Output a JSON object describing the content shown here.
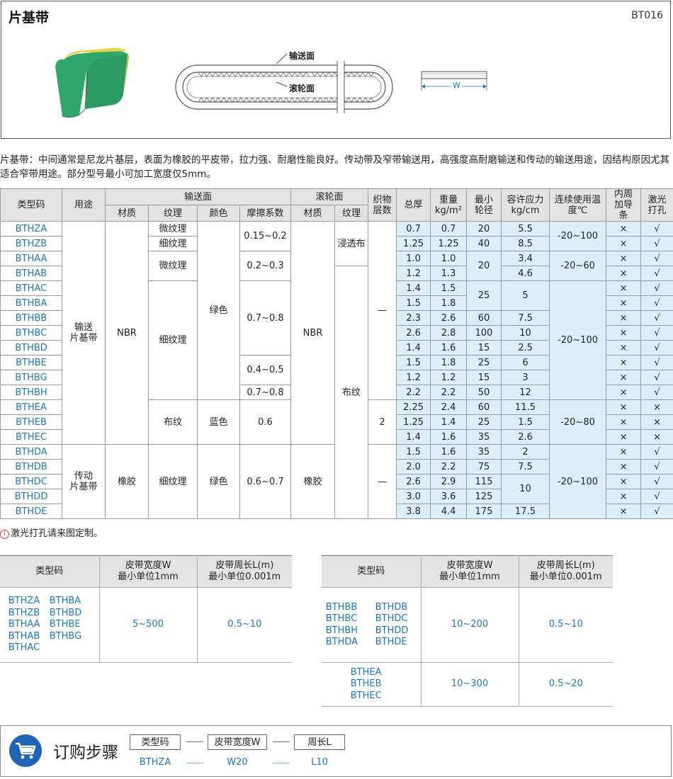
{
  "header": {
    "title": "片基带",
    "code": "BT016"
  },
  "diagram": {
    "convey_label": "输送面",
    "roller_label": "滚轮面",
    "width_label": "W"
  },
  "description": "片基带：中间通常是尼龙片基层，表面为橡胶的平皮带，拉力强、耐磨性能良好。传动带及窄带输送用，高强度高耐磨输送和传动的输送用途，因结构原因尤其适合窄带用途。部分型号最小可加工宽度仅5mm。",
  "spec_table": {
    "headers": {
      "model": "类型码",
      "usage": "用途",
      "convey": "输送面",
      "roller": "滚轮面",
      "plies": "织物层数",
      "thickness": "总厚",
      "weight": "重量",
      "weight_unit": "kg/m²",
      "min_pulley": "最小轮径",
      "stress": "容许应力",
      "stress_unit": "kg/cm",
      "temp": "连续使用温度℃",
      "guide": "内周加导条",
      "laser": "激光打孔",
      "material": "材质",
      "texture": "纹理",
      "color": "颜色",
      "friction": "摩擦系数"
    },
    "rows": [
      {
        "model": "BTHZA",
        "thickness": "0.7",
        "weight": "0.7",
        "pulley": "20",
        "stress": "5.5",
        "guide": "×",
        "laser": "√"
      },
      {
        "model": "BTHZB",
        "thickness": "1.25",
        "weight": "1.25",
        "pulley": "40",
        "stress": "8.5",
        "guide": "×",
        "laser": "√"
      },
      {
        "model": "BTHAA",
        "thickness": "1.0",
        "weight": "1.0",
        "pulley": "20",
        "stress": "3.4",
        "guide": "×",
        "laser": "√"
      },
      {
        "model": "BTHAB",
        "thickness": "1.2",
        "weight": "1.3",
        "pulley": "",
        "stress": "4.6",
        "guide": "×",
        "laser": "√"
      },
      {
        "model": "BTHAC",
        "thickness": "1.4",
        "weight": "1.5",
        "pulley": "25",
        "stress": "5",
        "guide": "×",
        "laser": "√"
      },
      {
        "model": "BTHBA",
        "thickness": "1.5",
        "weight": "1.8",
        "pulley": "",
        "stress": "",
        "guide": "×",
        "laser": "√"
      },
      {
        "model": "BTHBB",
        "thickness": "2.3",
        "weight": "2.6",
        "pulley": "60",
        "stress": "7.5",
        "guide": "×",
        "laser": "√"
      },
      {
        "model": "BTHBC",
        "thickness": "2.6",
        "weight": "2.8",
        "pulley": "100",
        "stress": "10",
        "guide": "×",
        "laser": "√"
      },
      {
        "model": "BTHBD",
        "thickness": "1.4",
        "weight": "1.6",
        "pulley": "15",
        "stress": "2.5",
        "guide": "×",
        "laser": "√"
      },
      {
        "model": "BTHBE",
        "thickness": "1.5",
        "weight": "1.8",
        "pulley": "25",
        "stress": "6",
        "guide": "×",
        "laser": "√"
      },
      {
        "model": "BTHBG",
        "thickness": "1.2",
        "weight": "1.2",
        "pulley": "15",
        "stress": "3",
        "guide": "×",
        "laser": "√"
      },
      {
        "model": "BTHBH",
        "thickness": "2.2",
        "weight": "2.2",
        "pulley": "50",
        "stress": "12",
        "guide": "×",
        "laser": "√"
      },
      {
        "model": "BTHEA",
        "thickness": "2.25",
        "weight": "2.4",
        "pulley": "60",
        "stress": "11.5",
        "guide": "×",
        "laser": "×"
      },
      {
        "model": "BTHEB",
        "thickness": "1.25",
        "weight": "1.4",
        "pulley": "25",
        "stress": "1.5",
        "guide": "×",
        "laser": "×"
      },
      {
        "model": "BTHEC",
        "thickness": "1.4",
        "weight": "1.6",
        "pulley": "35",
        "stress": "2.6",
        "guide": "×",
        "laser": "×"
      },
      {
        "model": "BTHDA",
        "thickness": "1.5",
        "weight": "1.6",
        "pulley": "35",
        "stress": "2",
        "guide": "×",
        "laser": "√"
      },
      {
        "model": "BTHDB",
        "thickness": "2.0",
        "weight": "2.2",
        "pulley": "75",
        "stress": "7.5",
        "guide": "×",
        "laser": "√"
      },
      {
        "model": "BTHDC",
        "thickness": "2.6",
        "weight": "2.9",
        "pulley": "115",
        "stress": "10",
        "guide": "×",
        "laser": "√"
      },
      {
        "model": "BTHDD",
        "thickness": "3.0",
        "weight": "3.6",
        "pulley": "125",
        "stress": "",
        "guide": "×",
        "laser": "√"
      },
      {
        "model": "BTHDE",
        "thickness": "3.8",
        "weight": "4.4",
        "pulley": "175",
        "stress": "17.5",
        "guide": "×",
        "laser": "√"
      }
    ],
    "groups": {
      "usage_a": "输送\n片基带",
      "usage_b": "传动\n片基带",
      "mat_nbr": "NBR",
      "mat_rubber": "橡胶",
      "tex_fine_micro": "微纹理",
      "tex_fine": "细纹理",
      "tex_cloth": "布纹",
      "green": "绿色",
      "blue": "蓝色",
      "f1": "0.15~0.2",
      "f2": "0.2~0.3",
      "f3": "0.7~0.8",
      "f4": "0.4~0.5",
      "f5": "0.7~0.8",
      "f6": "0.6",
      "f7": "0.6~0.7",
      "roller_soak": "浸透布",
      "roller_cloth": "布纹",
      "plies_dash": "—",
      "plies_two": "2",
      "t1": "-20~100",
      "t2": "-20~60",
      "t3": "-20~100",
      "t4": "-20~80",
      "t5": "-20~100"
    }
  },
  "note": "激光打孔请来图定制。",
  "size_tables": {
    "header_model": "类型码",
    "header_width": "皮带宽度W\n最小单位1mm",
    "header_length": "皮带周长L(m)\n最小单位0.001m",
    "left": {
      "models": [
        "BTHZA",
        "BTHBA",
        "BTHZB",
        "BTHBD",
        "BTHAA",
        "BTHBE",
        "BTHAB",
        "BTHBG",
        "BTHAC"
      ],
      "width": "5~500",
      "length": "0.5~10"
    },
    "right1": {
      "models": [
        "BTHBB",
        "BTHDB",
        "BTHBC",
        "BTHDC",
        "BTHBH",
        "BTHDD",
        "BTHDA",
        "BTHDE"
      ],
      "width": "10~200",
      "length": "0.5~10"
    },
    "right2": {
      "models": [
        "BTHEA",
        "BTHEB",
        "BTHEC"
      ],
      "width": "10~300",
      "length": "0.5~20"
    }
  },
  "order": {
    "title": "订购步骤",
    "labels": [
      "类型码",
      "皮带宽度W",
      "周长L"
    ],
    "examples": [
      "BTHZA",
      "W20",
      "L10"
    ],
    "separator": "—"
  }
}
